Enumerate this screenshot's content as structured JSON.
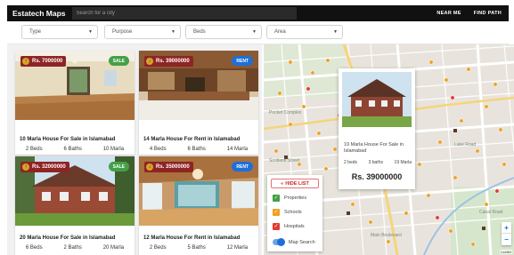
{
  "header": {
    "brand": "Estatech Maps",
    "search_placeholder": "Search for a city",
    "links": [
      "NEAR ME",
      "FIND PATH"
    ]
  },
  "filters": [
    {
      "label": "Type",
      "icon": "chevron-down-icon"
    },
    {
      "label": "Purpose",
      "icon": "chevron-down-icon"
    },
    {
      "label": "Beds",
      "icon": "chevron-down-icon"
    },
    {
      "label": "Area",
      "icon": "chevron-down-icon"
    }
  ],
  "listings": [
    {
      "price": "Rs. 7000000",
      "tag": "SALE",
      "title": "10 Marla House For Sale in Islamabad",
      "beds": "2 Beds",
      "baths": "6 Baths",
      "area": "10 Marla"
    },
    {
      "price": "Rs. 39000000",
      "tag": "RENT",
      "title": "14 Marla House For Rent in Islamabad",
      "beds": "4 Beds",
      "baths": "6 Baths",
      "area": "14 Marla"
    },
    {
      "price": "Rs. 32000000",
      "tag": "SALE",
      "title": "20 Marla House For Sale in Islamabad",
      "beds": "6 Beds",
      "baths": "2 Baths",
      "area": "20 Marla"
    },
    {
      "price": "Rs. 35000000",
      "tag": "RENT",
      "title": "12 Marla House For Rent in Islamabad",
      "beds": "2 Beds",
      "baths": "5 Baths",
      "area": "12 Marla"
    }
  ],
  "map": {
    "labels": [
      "Pocket Complex",
      "Scotland Street",
      "Lake Road",
      "Main Boulevard",
      "Canal Road"
    ],
    "popup": {
      "title": "19 Marla House For Sale in Islamabad",
      "beds": "2 beds",
      "baths": "3 baths",
      "area": "19 Marla",
      "price": "Rs. 39000000"
    },
    "legend": {
      "hide_label": "HIDE LIST",
      "items": [
        {
          "label": "Properties",
          "checked": true,
          "color": "#43a047"
        },
        {
          "label": "Schools",
          "checked": true,
          "color": "#f0a020"
        },
        {
          "label": "Hospitals",
          "checked": true,
          "color": "#e53935"
        }
      ],
      "toggle_label": "Map Search",
      "toggle_on": true
    },
    "zoom_in": "+",
    "zoom_out": "−",
    "attribution": "Leaflet"
  },
  "colors": {
    "accent": "#1e6fd9",
    "sale": "#43a047",
    "price_bg": "#8f2424",
    "topbar": "#111111"
  }
}
